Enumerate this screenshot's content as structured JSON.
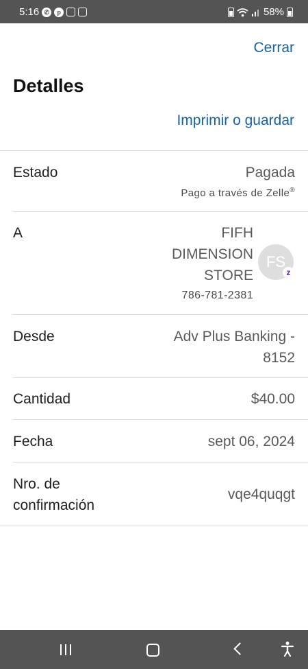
{
  "status_bar": {
    "time": "5:16",
    "battery": "58%",
    "left_icons": [
      "whatsapp-icon",
      "pinterest-icon",
      "instagram-icon",
      "gallery-icon"
    ],
    "right_icons": [
      "battery-saver-icon",
      "wifi-icon",
      "signal-icon",
      "battery-icon"
    ]
  },
  "header": {
    "close_label": "Cerrar",
    "title": "Detalles",
    "print_label": "Imprimir o guardar"
  },
  "details": {
    "estado": {
      "label": "Estado",
      "value": "Pagada",
      "sub_text": "Pago a través de Zelle",
      "sub_mark": "®"
    },
    "a": {
      "label": "A",
      "name_line1": "FIFH",
      "name_line2": "DIMENSION",
      "name_line3": "STORE",
      "phone": "786-781-2381",
      "avatar_initials": "FS",
      "badge_icon": "zelle-icon"
    },
    "desde": {
      "label": "Desde",
      "value_line1": "Adv Plus Banking -",
      "value_line2": "8152"
    },
    "cantidad": {
      "label": "Cantidad",
      "value": "$40.00"
    },
    "fecha": {
      "label": "Fecha",
      "value": "sept 06, 2024"
    },
    "confirmacion": {
      "label_line1": "Nro. de",
      "label_line2": "confirmación",
      "value": "vqe4quqgt"
    }
  },
  "colors": {
    "link": "#1663a8",
    "status_bar": "#545454",
    "zelle": "#6d1ed4"
  },
  "nav_bar": {
    "icons": [
      "recent-apps-icon",
      "home-icon",
      "back-icon",
      "accessibility-icon"
    ]
  }
}
